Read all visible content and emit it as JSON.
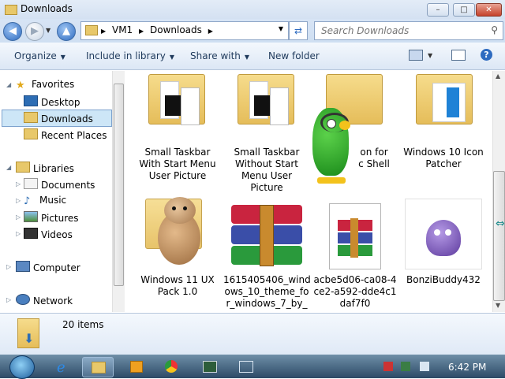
{
  "window": {
    "title": "Downloads",
    "min_label": "–",
    "max_label": "□",
    "close_label": "✕"
  },
  "navigation": {
    "back_label": "◀",
    "forward_label": "▶",
    "up_label": "▲",
    "breadcrumb": [
      "VM1",
      "Downloads"
    ],
    "search_placeholder": "Search Downloads"
  },
  "toolbar": {
    "organize": "Organize",
    "include_in_library": "Include in library",
    "share_with": "Share with",
    "new_folder": "New folder"
  },
  "nav_pane": {
    "favorites": "Favorites",
    "favorites_items": [
      "Desktop",
      "Downloads",
      "Recent Places"
    ],
    "libraries": "Libraries",
    "libraries_items": [
      "Documents",
      "Music",
      "Pictures",
      "Videos"
    ],
    "computer": "Computer",
    "network": "Network",
    "selected": "Downloads"
  },
  "files": [
    {
      "line1": "Small Taskbar",
      "line2": "With Start Menu",
      "line3": "User Picture",
      "line4": ""
    },
    {
      "line1": "Small Taskbar",
      "line2": "Without Start",
      "line3": "Menu User",
      "line4": "Picture"
    },
    {
      "line1": "on for",
      "line2": "c Shell",
      "line3": "",
      "line4": ""
    },
    {
      "line1": "Windows 10 Icon",
      "line2": "Patcher",
      "line3": "",
      "line4": ""
    },
    {
      "line1": "Windows 11 UX",
      "line2": "Pack 1.0",
      "line3": "",
      "line4": ""
    },
    {
      "line1": "1615405406_wind",
      "line2": "ows_10_theme_fo",
      "line3": "r_windows_7_by_",
      "line4": ""
    },
    {
      "line1": "acbe5d06-ca08-4",
      "line2": "ce2-a592-dde4c1",
      "line3": "daf7f0",
      "line4": ""
    },
    {
      "line1": "BonziBuddy432",
      "line2": "",
      "line3": "",
      "line4": ""
    }
  ],
  "details": {
    "item_count": "20 items"
  },
  "taskbar": {
    "clock": "6:42 PM"
  },
  "icons": [
    "back-arrow-icon",
    "forward-arrow-icon",
    "up-arrow-icon",
    "folder-icon",
    "refresh-icon",
    "search-icon",
    "star-icon",
    "desktop-icon",
    "library-icon",
    "computer-icon",
    "network-icon",
    "parrot-agent-icon",
    "hamster-agent-icon",
    "winrar-icon",
    "bonzi-icon",
    "ie-icon",
    "explorer-icon",
    "media-player-icon",
    "chrome-icon",
    "volume-icon",
    "network-tray-icon"
  ]
}
